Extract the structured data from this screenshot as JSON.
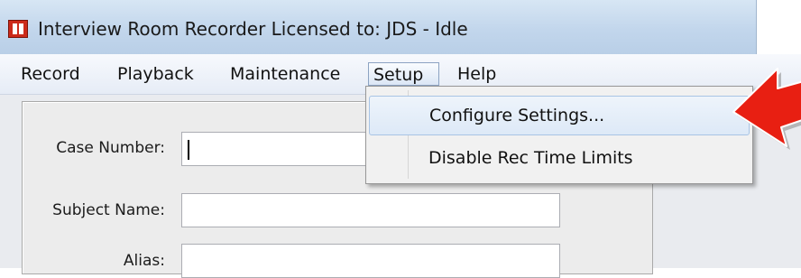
{
  "window": {
    "title": "Interview Room Recorder Licensed to: JDS - Idle",
    "icon": "red-app-icon"
  },
  "menubar": {
    "items": [
      "Record",
      "Playback",
      "Maintenance",
      "Setup",
      "Help"
    ]
  },
  "setup_menu": {
    "items": [
      "Configure Settings...",
      "Disable Rec Time Limits"
    ]
  },
  "form": {
    "case_number_label": "Case Number:",
    "case_number_value": "",
    "subject_name_label": "Subject Name:",
    "subject_name_value": "",
    "alias_label": "Alias:",
    "alias_value": ""
  },
  "colors": {
    "arrow": "#e81f12",
    "titlebar": "#c2d6ec"
  }
}
